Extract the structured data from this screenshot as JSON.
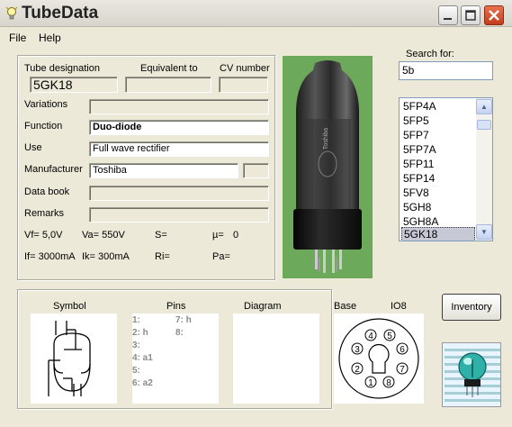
{
  "window": {
    "title": "TubeData"
  },
  "menu": [
    {
      "label": "File"
    },
    {
      "label": "Help"
    }
  ],
  "details": {
    "designation_label": "Tube designation",
    "equivalent_label": "Equivalent to",
    "cv_label": "CV number",
    "designation": "5GK18",
    "equivalent": "",
    "cv_number": "",
    "variations_label": "Variations",
    "variations": "",
    "function_label": "Function",
    "function": "Duo-diode",
    "use_label": "Use",
    "use": "Full wave rectifier",
    "manufacturer_label": "Manufacturer",
    "manufacturer": "Toshiba",
    "manufacturer_code": "",
    "databook_label": "Data book",
    "databook": "",
    "remarks_label": "Remarks",
    "remarks": ""
  },
  "params": {
    "vf": "Vf= 5,0V",
    "va": "Va= 550V",
    "s": "S=",
    "mu": "µ=",
    "mu_val": "0",
    "if": "If= 3000mA",
    "ik": "Ik= 300mA",
    "ri": "Ri=",
    "pa": "Pa="
  },
  "search": {
    "label": "Search for:",
    "value": "5b"
  },
  "tube_list": {
    "items": [
      "5FP4A",
      "5FP5",
      "5FP7",
      "5FP7A",
      "5FP11",
      "5FP14",
      "5FV8",
      "5GH8",
      "5GH8A",
      "5GK18"
    ],
    "selected": "5GK18"
  },
  "bottom": {
    "symbol_label": "Symbol",
    "pins_label": "Pins",
    "diagram_label": "Diagram",
    "base_label": "Base",
    "base_type": "IO8",
    "pins_left": [
      "1:",
      "2: h",
      "3:",
      "4: a1",
      "5:",
      "6: a2"
    ],
    "pins_right": [
      "7: h",
      "8:"
    ],
    "base_pin_numbers": [
      "1",
      "2",
      "3",
      "4",
      "5",
      "6",
      "7",
      "8"
    ]
  },
  "buttons": {
    "inventory": "Inventory"
  },
  "photo_label": "Toshiba"
}
